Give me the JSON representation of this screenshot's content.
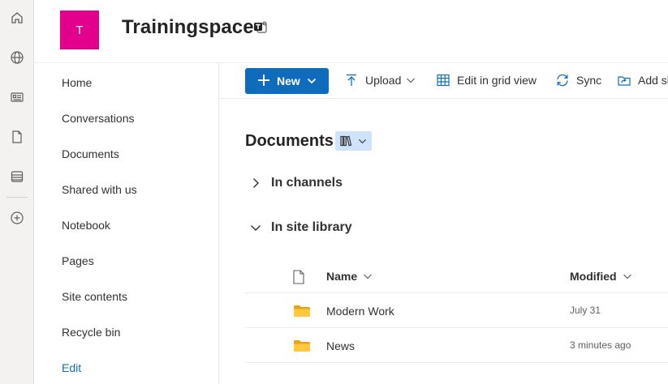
{
  "site": {
    "logo_letter": "T",
    "title": "Trainingspace"
  },
  "rail": {
    "items": [
      "home-icon",
      "globe-icon",
      "news-icon",
      "file-icon",
      "list-icon",
      "create-icon"
    ]
  },
  "leftnav": {
    "items": [
      "Home",
      "Conversations",
      "Documents",
      "Shared with us",
      "Notebook",
      "Pages",
      "Site contents",
      "Recycle bin"
    ],
    "edit_label": "Edit"
  },
  "commandbar": {
    "new_label": "New",
    "upload_label": "Upload",
    "grid_label": "Edit in grid view",
    "sync_label": "Sync",
    "add_label": "Add sh"
  },
  "main": {
    "title": "Documents",
    "sections": {
      "channels": "In channels",
      "site_library": "In site library"
    },
    "columns": {
      "name": "Name",
      "modified": "Modified"
    },
    "rows": [
      {
        "name": "Modern Work",
        "modified": "July 31"
      },
      {
        "name": "News",
        "modified": "3 minutes ago"
      }
    ]
  },
  "colors": {
    "accent": "#0f6cbd",
    "site_logo": "#e3008c",
    "folder": "#ffb900"
  }
}
